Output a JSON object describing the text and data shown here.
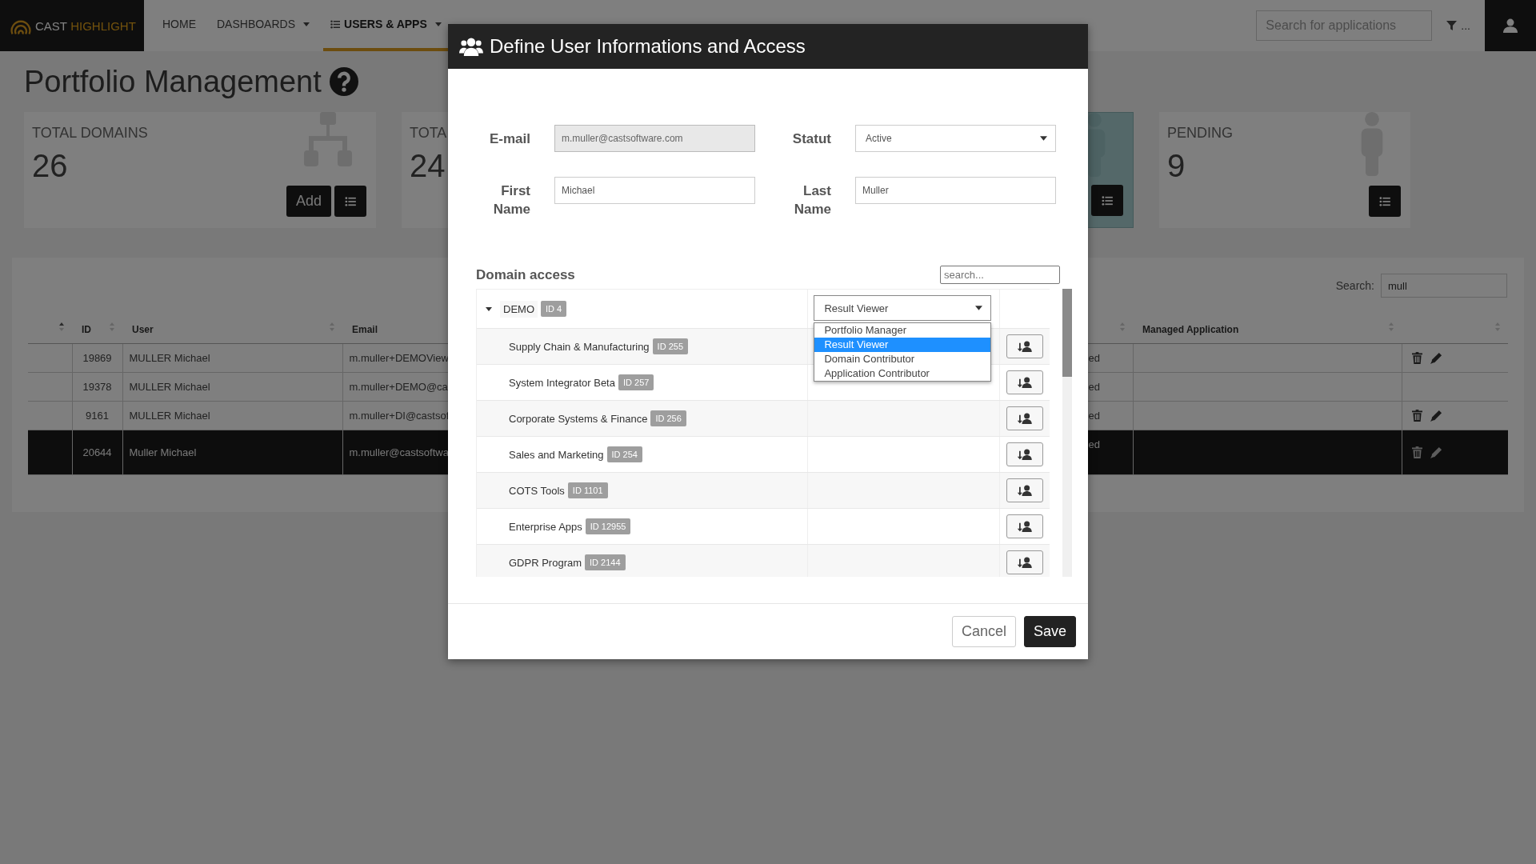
{
  "navbar": {
    "logo": {
      "brand": "CAST",
      "product": "HIGHLIGHT"
    },
    "items": [
      {
        "label": "HOME",
        "kind": "plain",
        "selected": false
      },
      {
        "label": "DASHBOARDS",
        "kind": "menu",
        "selected": false
      },
      {
        "label": "USERS & APPS",
        "kind": "icon-menu",
        "selected": true
      }
    ],
    "search": {
      "placeholder": "Search for applications"
    },
    "filter_label": "..."
  },
  "page": {
    "title": "Portfolio Management",
    "cards": [
      {
        "kind": "domains",
        "label": "TOTAL DOMAINS",
        "value": "26",
        "highlighted": false,
        "buttons": [
          "Add"
        ],
        "list_button": true
      },
      {
        "kind": "plain",
        "label": "TOTA",
        "value": "24",
        "highlighted": false,
        "list_button": false
      },
      {
        "kind": "users",
        "highlighted": true,
        "list_button": true
      },
      {
        "kind": "users",
        "label": "PENDING",
        "value": "9",
        "highlighted": false,
        "list_button": true
      }
    ],
    "table": {
      "search_label": "Search:",
      "search_value": "mull",
      "columns": [
        {
          "sorted": true
        },
        {
          "label": "ID",
          "sorted": false
        },
        {
          "label": "User",
          "sorted": false
        },
        {
          "label": "Email"
        },
        {
          "sorted": false
        },
        {
          "label": "Managed Application",
          "sorted": false
        },
        {
          "sorted": false
        }
      ],
      "rows": [
        {
          "id": "19869",
          "user": "MULLER Michael",
          "email": "m.muller+DEMOView",
          "status": "ed",
          "actions": true,
          "selected": false
        },
        {
          "id": "19378",
          "user": "MULLER Michael",
          "email": "m.muller+DEMO@ca",
          "status": "ed",
          "actions": false,
          "selected": false
        },
        {
          "id": "9161",
          "user": "MULLER Michael",
          "email": "m.muller+DI@castsof",
          "status": "ed",
          "actions": true,
          "selected": false
        },
        {
          "id": "20644",
          "user": "Muller Michael",
          "email": "m.muller@castsoftwa",
          "status": "ed",
          "actions": true,
          "selected": true
        }
      ]
    }
  },
  "modal": {
    "title": "Define User Informations and Access",
    "fields": [
      {
        "label": "E-mail",
        "kind": "input",
        "value": "m.muller@castsoftware.com",
        "disabled": true
      },
      {
        "label": "Statut",
        "kind": "select",
        "value": "Active",
        "disabled": false
      },
      {
        "label": "First Name",
        "kind": "input",
        "value": "Michael",
        "disabled": false
      },
      {
        "label": "Last Name",
        "kind": "input",
        "value": "Muller",
        "disabled": false
      }
    ],
    "domain_access": {
      "heading": "Domain access",
      "search_placeholder": "search...",
      "tree": [
        {
          "name": "DEMO",
          "badge": "ID 4",
          "expanded": true,
          "role": {
            "value": "Result Viewer",
            "open": true,
            "options": [
              {
                "label": "Portfolio Manager",
                "selected": false
              },
              {
                "label": "Result Viewer",
                "selected": true
              },
              {
                "label": "Domain Contributor",
                "selected": false
              },
              {
                "label": "Application Contributor",
                "selected": false
              }
            ]
          },
          "children": [
            {
              "name": "Supply Chain & Manufacturing",
              "badge": "ID 255"
            },
            {
              "name": "System Integrator Beta",
              "badge": "ID 257"
            },
            {
              "name": "Corporate Systems & Finance",
              "badge": "ID 256"
            },
            {
              "name": "Sales and Marketing",
              "badge": "ID 254"
            },
            {
              "name": "COTS Tools",
              "badge": "ID 1101"
            },
            {
              "name": "Enterprise Apps",
              "badge": "ID 12955"
            },
            {
              "name": "GDPR Program",
              "badge": "ID 2144"
            }
          ]
        }
      ]
    },
    "buttons": [
      {
        "label": "Cancel",
        "kind": "secondary"
      },
      {
        "label": "Save",
        "kind": "primary"
      }
    ]
  }
}
